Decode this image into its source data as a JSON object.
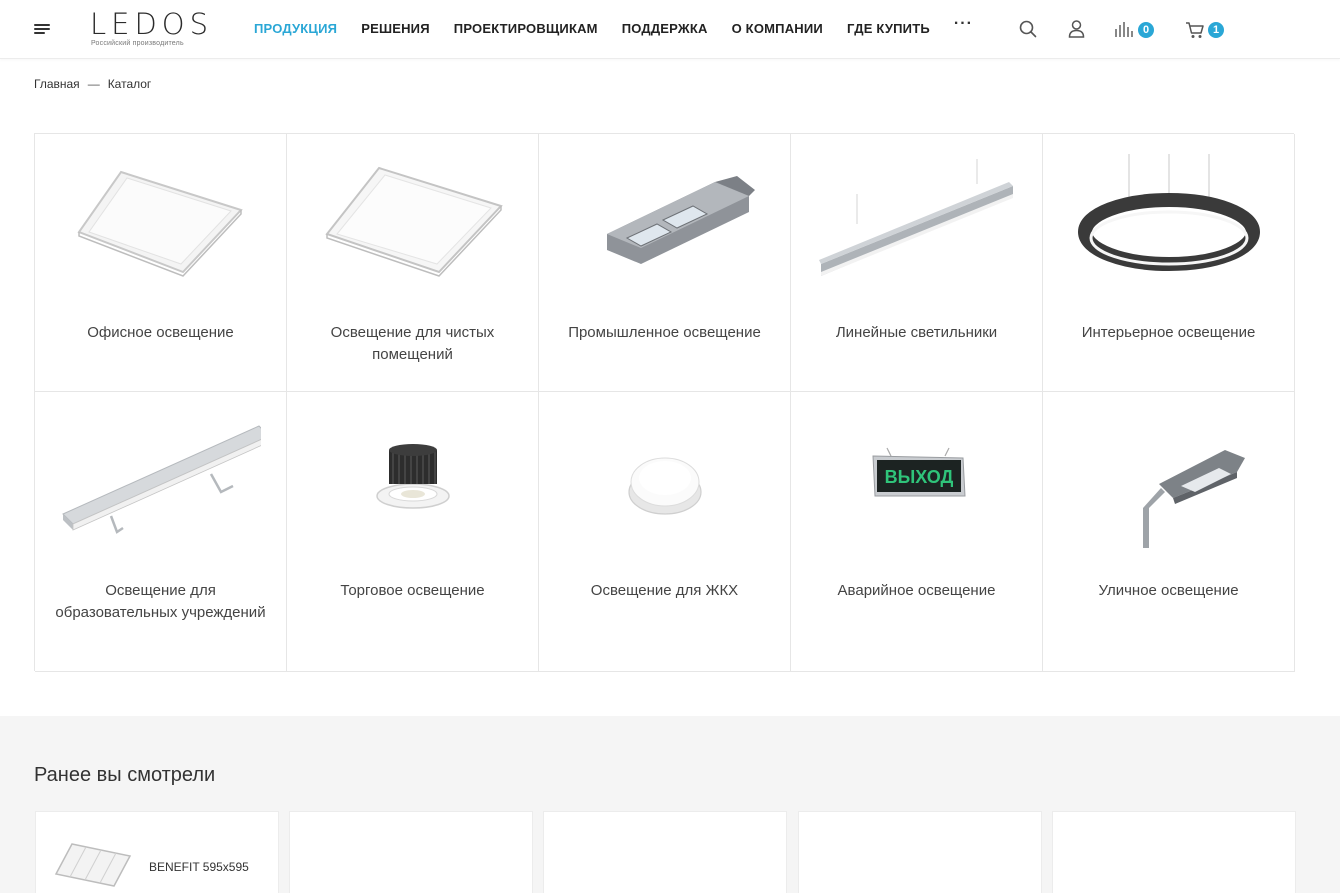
{
  "header": {
    "logo_text": "LEDOS",
    "logo_sub": "Российский производитель",
    "nav": [
      {
        "label": "ПРОДУКЦИЯ",
        "active": true
      },
      {
        "label": "РЕШЕНИЯ"
      },
      {
        "label": "ПРОЕКТИРОВЩИКАМ"
      },
      {
        "label": "ПОДДЕРЖКА"
      },
      {
        "label": "О КОМПАНИИ"
      },
      {
        "label": "ГДЕ КУПИТЬ"
      }
    ],
    "more_label": "···",
    "compare_count": "0",
    "cart_count": "1",
    "accent_color": "#2aa7d6"
  },
  "breadcrumb": {
    "home": "Главная",
    "separator": "—",
    "current": "Каталог"
  },
  "catalog": [
    {
      "label": "Офисное освещение",
      "icon": "square-panel-light"
    },
    {
      "label": "Освещение для чистых помещений",
      "icon": "square-panel-light"
    },
    {
      "label": "Промышленное освещение",
      "icon": "industrial-light"
    },
    {
      "label": "Линейные светильники",
      "icon": "linear-light"
    },
    {
      "label": "Интерьерное освещение",
      "icon": "ring-pendant-light"
    },
    {
      "label": "Освещение для образовательных учреждений",
      "icon": "board-light"
    },
    {
      "label": "Торговое освещение",
      "icon": "downlight"
    },
    {
      "label": "Освещение для ЖКХ",
      "icon": "round-ceiling-light"
    },
    {
      "label": "Аварийное освещение",
      "icon": "exit-sign"
    },
    {
      "label": "Уличное освещение",
      "icon": "street-light"
    }
  ],
  "exit_sign_text": "ВЫХОД",
  "recent": {
    "title": "Ранее вы смотрели",
    "items": [
      {
        "name": "BENEFIT 595x595"
      },
      {
        "name": ""
      },
      {
        "name": ""
      },
      {
        "name": ""
      },
      {
        "name": ""
      }
    ]
  }
}
